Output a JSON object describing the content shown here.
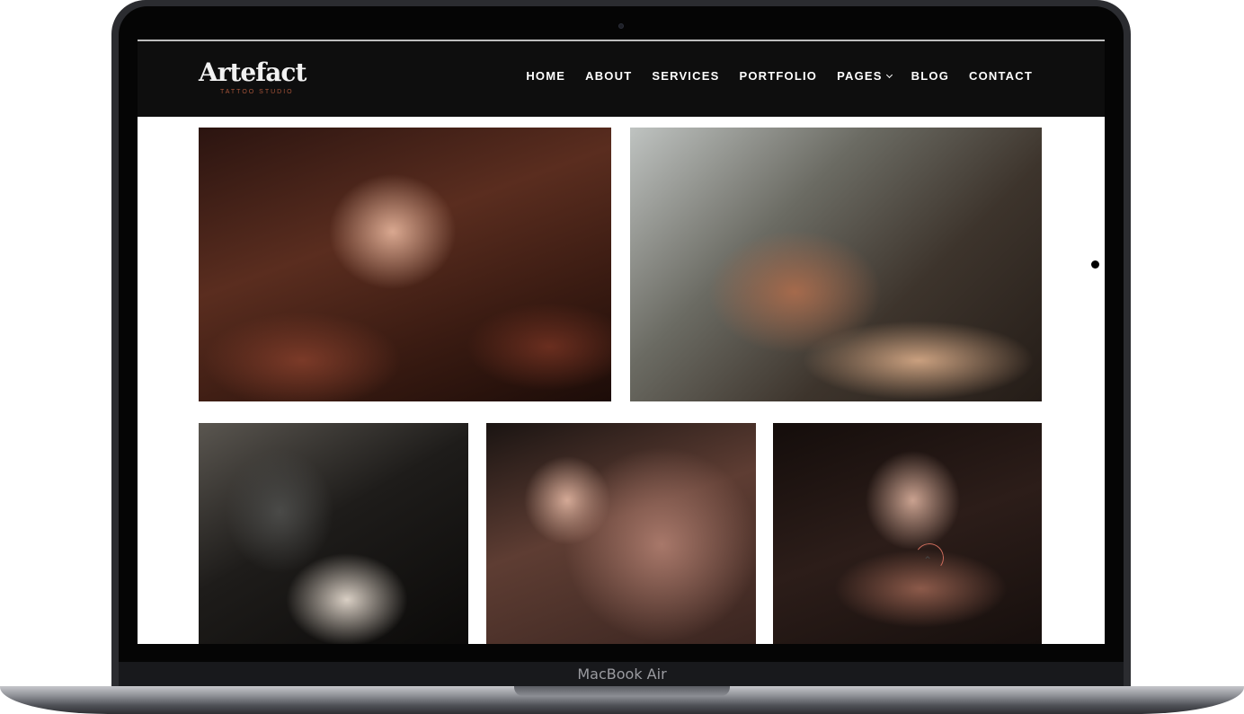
{
  "device": {
    "brand_label": "MacBook Air"
  },
  "site": {
    "logo": {
      "wordmark": "Artefact",
      "tagline": "TATTOO STUDIO"
    },
    "nav": [
      {
        "label": "HOME"
      },
      {
        "label": "ABOUT"
      },
      {
        "label": "SERVICES"
      },
      {
        "label": "PORTFOLIO"
      },
      {
        "label": "PAGES",
        "has_dropdown": true
      },
      {
        "label": "BLOG"
      },
      {
        "label": "CONTACT"
      }
    ]
  },
  "colors": {
    "header_bg": "#0e0e0e",
    "accent": "#a8553a",
    "frame": "#2b2c30"
  },
  "icons": {
    "dropdown": "chevron-down-icon",
    "back_to_top": "chevron-up-icon"
  }
}
